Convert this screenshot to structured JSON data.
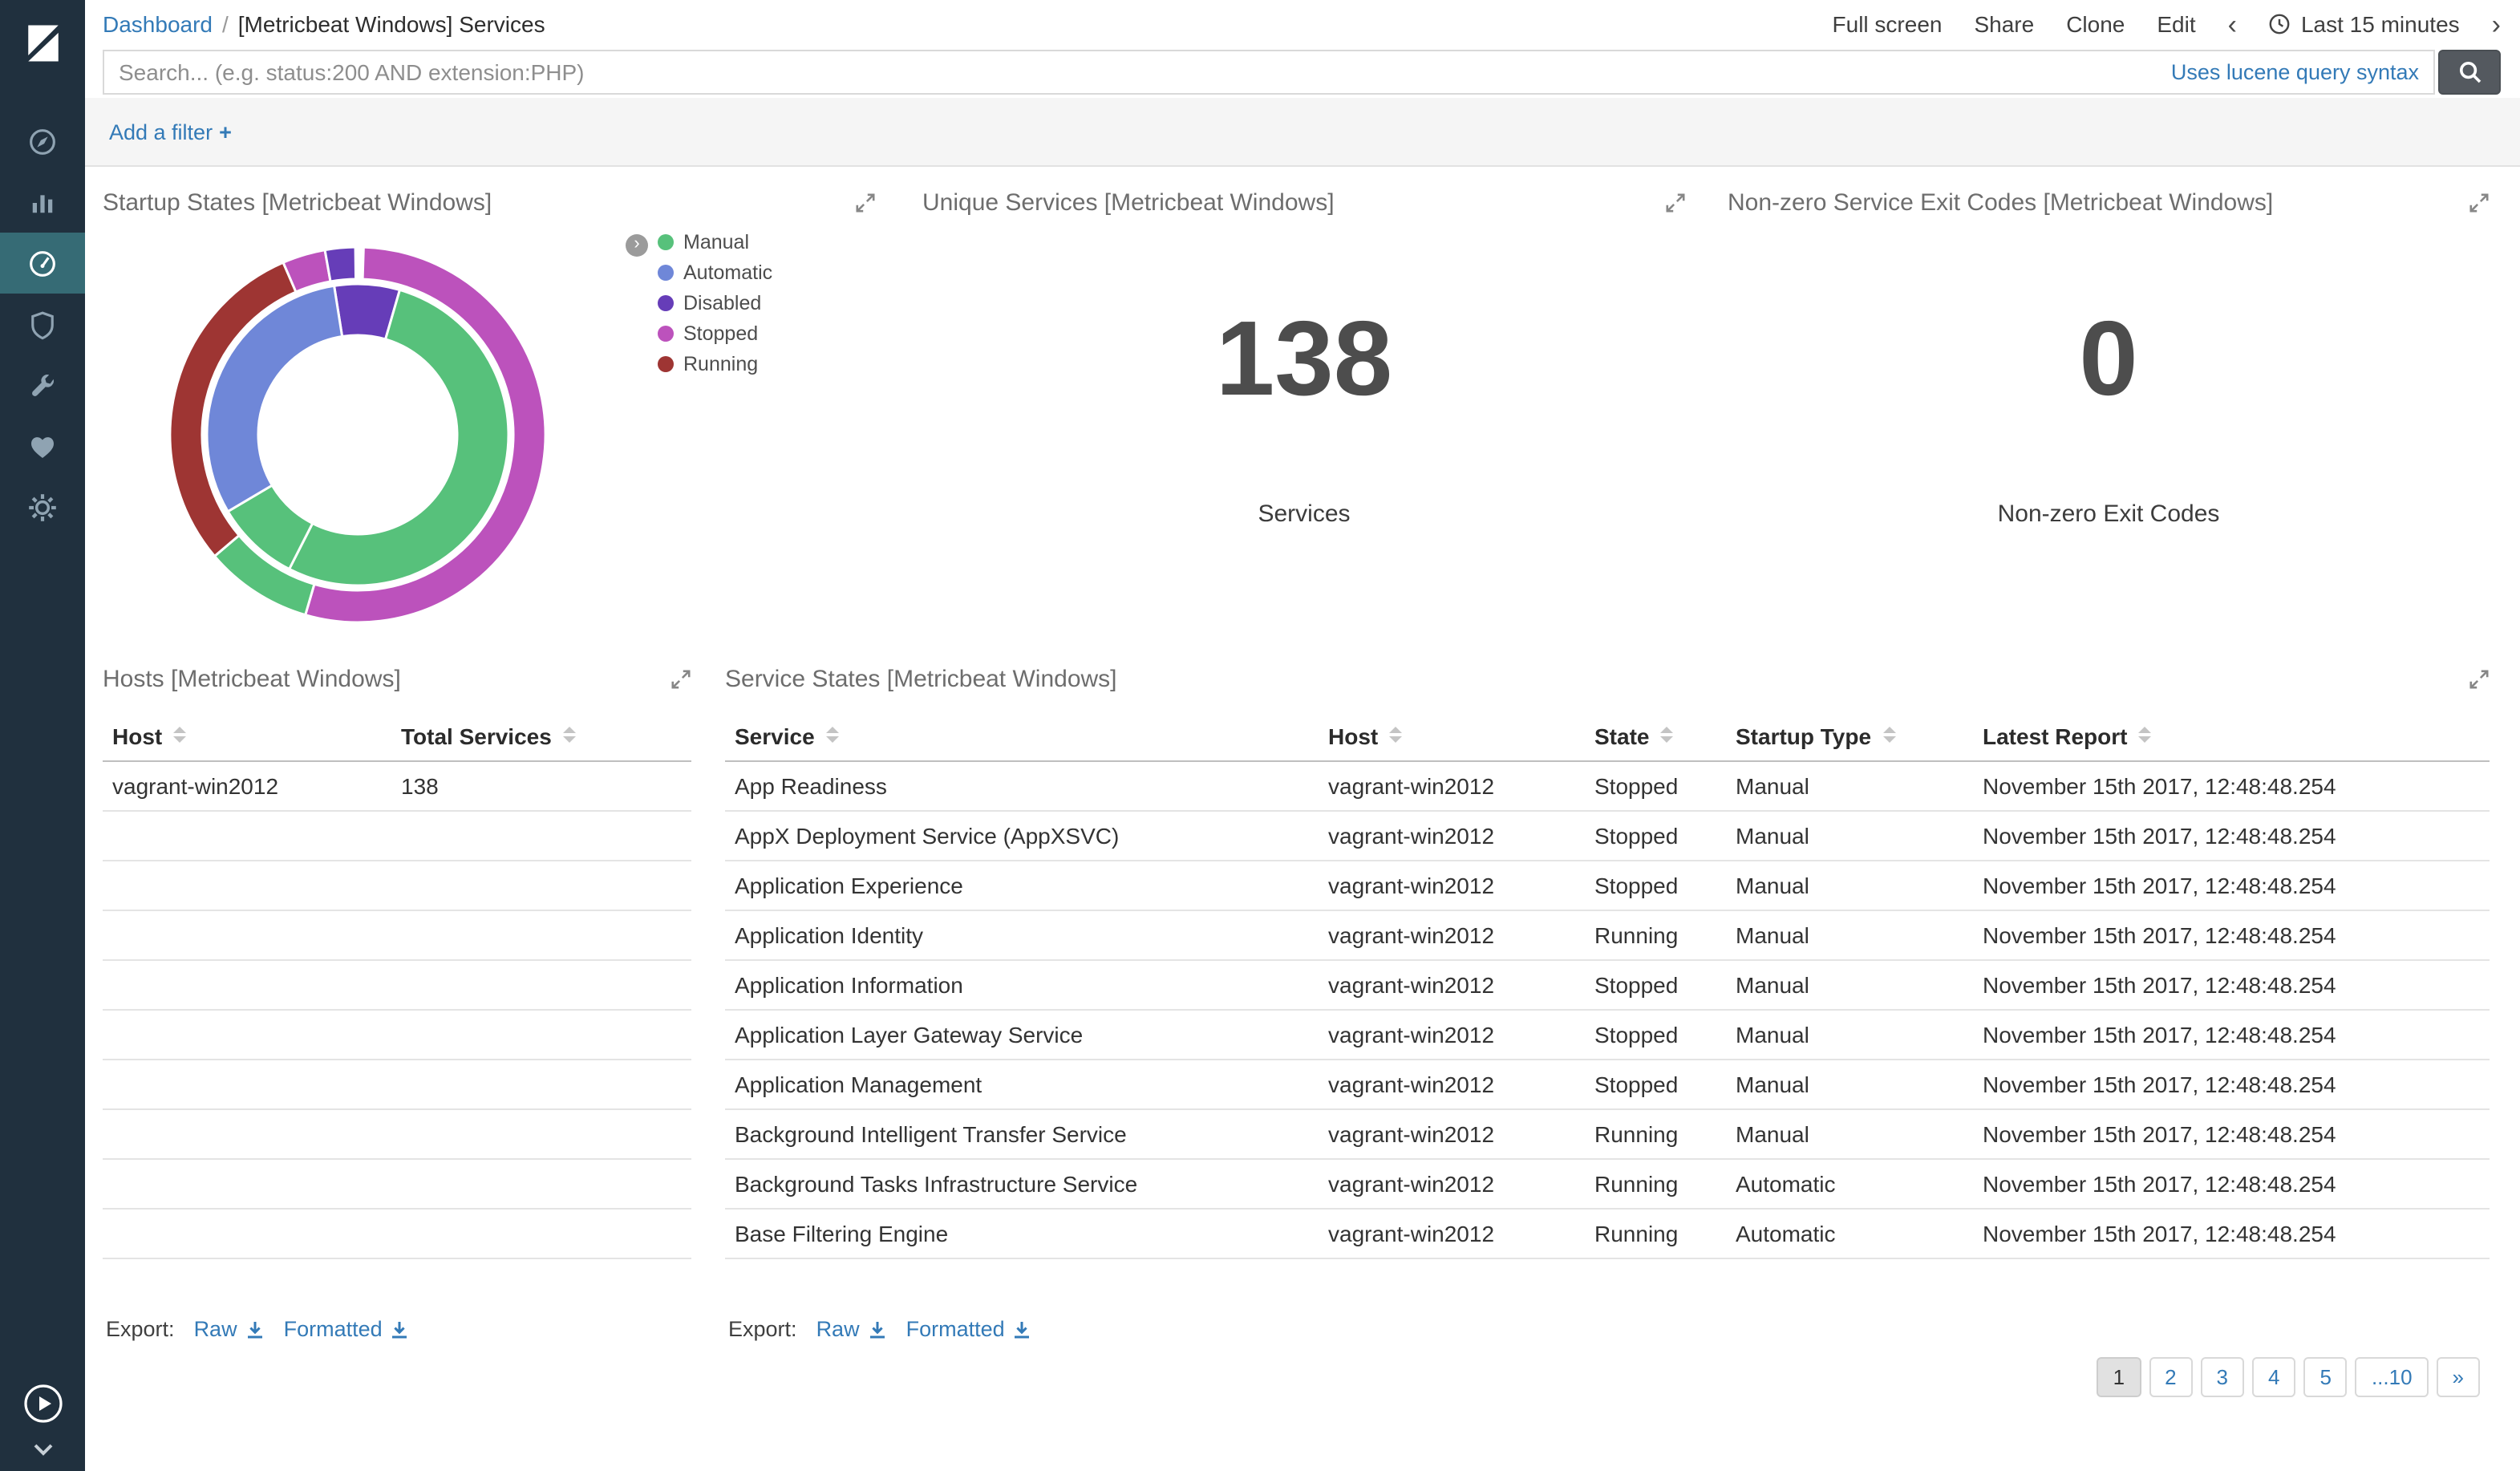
{
  "topbar": {
    "breadcrumb_root": "Dashboard",
    "breadcrumb_sep": "/",
    "breadcrumb_current": "[Metricbeat Windows] Services",
    "actions": [
      "Full screen",
      "Share",
      "Clone",
      "Edit"
    ],
    "time_back": "‹",
    "time_label": "Last 15 minutes",
    "time_forward": "›"
  },
  "search": {
    "placeholder": "Search... (e.g. status:200 AND extension:PHP)",
    "syntax_link": "Uses lucene query syntax"
  },
  "filter_bar": {
    "add_filter_label": "Add a filter",
    "plus": "+"
  },
  "sidebar": {
    "icons": [
      "kibana-logo",
      "compass-icon",
      "bar-chart-icon",
      "gauge-icon",
      "shield-icon",
      "wrench-icon",
      "heartbeat-icon",
      "gear-icon",
      "play-circle-icon",
      "chevron-down-icon"
    ],
    "active_item": "dashboard"
  },
  "panels": {
    "startup": {
      "title": "Startup States [Metricbeat Windows]",
      "legend_toggle_glyph": "›",
      "legend": [
        {
          "label": "Manual",
          "color": "#57c17b"
        },
        {
          "label": "Automatic",
          "color": "#6f87d8"
        },
        {
          "label": "Disabled",
          "color": "#663db8"
        },
        {
          "label": "Stopped",
          "color": "#bc52bc"
        },
        {
          "label": "Running",
          "color": "#9e3533"
        }
      ]
    },
    "unique": {
      "title": "Unique Services [Metricbeat Windows]",
      "value": "138",
      "label": "Services"
    },
    "exit": {
      "title": "Non-zero Service Exit Codes [Metricbeat Windows]",
      "value": "0",
      "label": "Non-zero Exit Codes"
    },
    "hosts": {
      "title": "Hosts [Metricbeat Windows]",
      "columns": [
        "Host",
        "Total Services"
      ],
      "rows": [
        [
          "vagrant-win2012",
          "138"
        ]
      ],
      "empty_rows": 9,
      "export_label": "Export:",
      "export_raw": "Raw",
      "export_formatted": "Formatted"
    },
    "services": {
      "title": "Service States [Metricbeat Windows]",
      "columns": [
        "Service",
        "Host",
        "State",
        "Startup Type",
        "Latest Report"
      ],
      "rows": [
        [
          "App Readiness",
          "vagrant-win2012",
          "Stopped",
          "Manual",
          "November 15th 2017, 12:48:48.254"
        ],
        [
          "AppX Deployment Service (AppXSVC)",
          "vagrant-win2012",
          "Stopped",
          "Manual",
          "November 15th 2017, 12:48:48.254"
        ],
        [
          "Application Experience",
          "vagrant-win2012",
          "Stopped",
          "Manual",
          "November 15th 2017, 12:48:48.254"
        ],
        [
          "Application Identity",
          "vagrant-win2012",
          "Running",
          "Manual",
          "November 15th 2017, 12:48:48.254"
        ],
        [
          "Application Information",
          "vagrant-win2012",
          "Stopped",
          "Manual",
          "November 15th 2017, 12:48:48.254"
        ],
        [
          "Application Layer Gateway Service",
          "vagrant-win2012",
          "Stopped",
          "Manual",
          "November 15th 2017, 12:48:48.254"
        ],
        [
          "Application Management",
          "vagrant-win2012",
          "Stopped",
          "Manual",
          "November 15th 2017, 12:48:48.254"
        ],
        [
          "Background Intelligent Transfer Service",
          "vagrant-win2012",
          "Running",
          "Manual",
          "November 15th 2017, 12:48:48.254"
        ],
        [
          "Background Tasks Infrastructure Service",
          "vagrant-win2012",
          "Running",
          "Automatic",
          "November 15th 2017, 12:48:48.254"
        ],
        [
          "Base Filtering Engine",
          "vagrant-win2012",
          "Running",
          "Automatic",
          "November 15th 2017, 12:48:48.254"
        ]
      ],
      "export_label": "Export:",
      "export_raw": "Raw",
      "export_formatted": "Formatted",
      "pagination": [
        "1",
        "2",
        "3",
        "4",
        "5",
        "...10",
        "»"
      ],
      "active_page": "1"
    }
  },
  "chart_data": [
    {
      "type": "pie",
      "title": "Startup States [Metricbeat Windows]",
      "legend": [
        "Manual",
        "Automatic",
        "Disabled",
        "Stopped",
        "Running"
      ],
      "legend_position": "right",
      "donut": true,
      "colors": {
        "Manual": "#57c17b",
        "Automatic": "#6f87d8",
        "Disabled": "#663db8",
        "Stopped": "#bc52bc",
        "Running": "#9e3533"
      },
      "rings": [
        {
          "name": "inner-startup-type",
          "segments": [
            {
              "label": "Disabled",
              "start": 0.975,
              "end": 1.045
            },
            {
              "label": "Manual",
              "start": 0.045,
              "end": 0.575
            },
            {
              "label": "Manual",
              "start": 0.575,
              "end": 0.665
            },
            {
              "label": "Automatic",
              "start": 0.665,
              "end": 0.975
            }
          ]
        },
        {
          "name": "outer-state",
          "segments": [
            {
              "label": "Stopped",
              "start": 0.005,
              "end": 0.545
            },
            {
              "label": "Manual",
              "start": 0.545,
              "end": 0.638
            },
            {
              "label": "Running",
              "start": 0.638,
              "end": 0.935
            },
            {
              "label": "Stopped",
              "start": 0.935,
              "end": 0.972
            },
            {
              "label": "Disabled",
              "start": 0.972,
              "end": 0.998
            }
          ]
        }
      ]
    },
    {
      "type": "metric",
      "title": "Unique Services [Metricbeat Windows]",
      "value": 138,
      "label": "Services"
    },
    {
      "type": "metric",
      "title": "Non-zero Service Exit Codes [Metricbeat Windows]",
      "value": 0,
      "label": "Non-zero Exit Codes"
    }
  ]
}
